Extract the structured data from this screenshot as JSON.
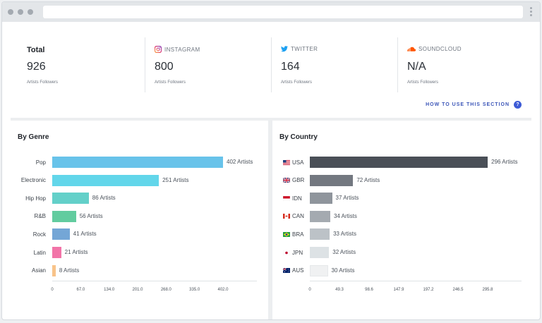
{
  "stats": [
    {
      "title": "Total",
      "value": "926",
      "subtitle": "Artists Followers",
      "icon": ""
    },
    {
      "title": "INSTAGRAM",
      "value": "800",
      "subtitle": "Artists Followers",
      "icon": "instagram-icon"
    },
    {
      "title": "TWITTER",
      "value": "164",
      "subtitle": "Artists Followers",
      "icon": "twitter-icon"
    },
    {
      "title": "SOUNDCLOUD",
      "value": "N/A",
      "subtitle": "Artists Followers",
      "icon": "soundcloud-icon"
    }
  ],
  "help_link": {
    "label": "HOW TO USE THIS SECTION",
    "icon": "question-icon"
  },
  "genre_panel": {
    "title": "By Genre"
  },
  "country_panel": {
    "title": "By Country"
  },
  "chart_data": [
    {
      "type": "bar",
      "orientation": "horizontal",
      "title": "By Genre",
      "categories": [
        "Pop",
        "Electronic",
        "Hip Hop",
        "R&B",
        "Rock",
        "Latin",
        "Asian"
      ],
      "values": [
        402,
        251,
        86,
        56,
        41,
        21,
        8
      ],
      "value_labels": [
        "402 Artists",
        "251 Artists",
        "86 Artists",
        "56 Artists",
        "41 Artists",
        "21 Artists",
        "8 Artists"
      ],
      "colors": [
        "#68c3ea",
        "#62d6ea",
        "#63d0c9",
        "#62cc9f",
        "#74a6d6",
        "#f274a8",
        "#f8c389"
      ],
      "xticks": [
        "0",
        "67.0",
        "134.0",
        "201.0",
        "268.0",
        "335.0",
        "402.0"
      ],
      "xlim": [
        0,
        402
      ]
    },
    {
      "type": "bar",
      "orientation": "horizontal",
      "title": "By Country",
      "categories": [
        "USA",
        "GBR",
        "IDN",
        "CAN",
        "BRA",
        "JPN",
        "AUS"
      ],
      "values": [
        296,
        72,
        37,
        34,
        33,
        32,
        30
      ],
      "value_labels": [
        "296 Artists",
        "72 Artists",
        "37 Artists",
        "34 Artists",
        "33 Artists",
        "32 Artists",
        "30 Artists"
      ],
      "colors": [
        "#4a4f57",
        "#737880",
        "#8f959c",
        "#a4aab0",
        "#bcc2c7",
        "#dde2e5",
        "#f0f1f2"
      ],
      "flags": [
        "usa-flag-icon",
        "gbr-flag-icon",
        "idn-flag-icon",
        "can-flag-icon",
        "bra-flag-icon",
        "jpn-flag-icon",
        "aus-flag-icon"
      ],
      "xticks": [
        "0",
        "49.3",
        "98.6",
        "147.9",
        "197.2",
        "246.5",
        "295.8"
      ],
      "xlim": [
        0,
        295.8
      ]
    }
  ]
}
